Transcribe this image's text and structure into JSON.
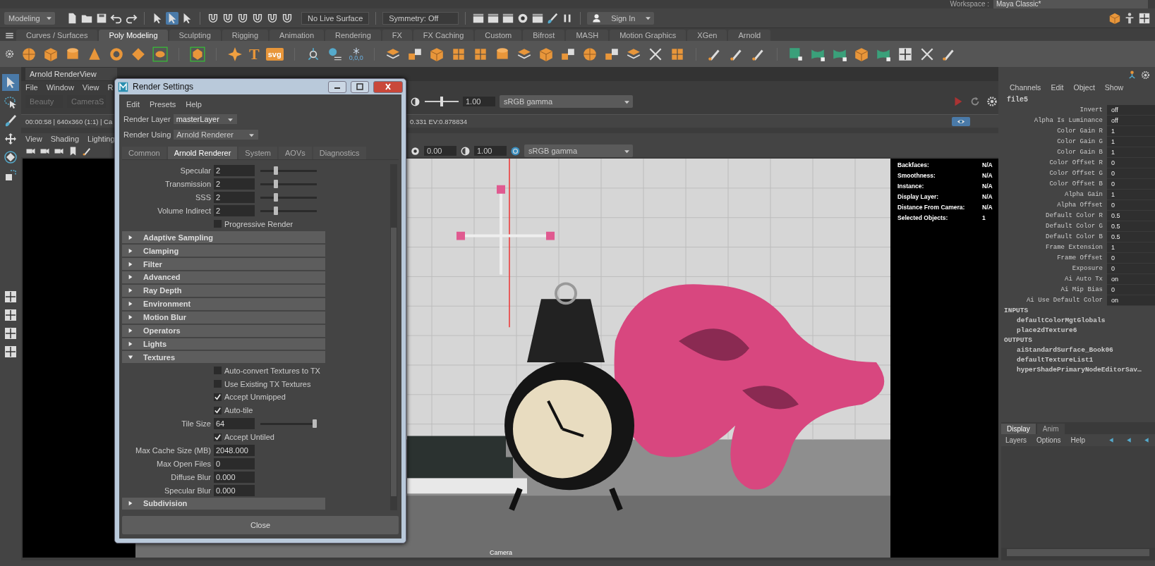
{
  "workspace": {
    "label": "Workspace :",
    "value": "Maya Classic*"
  },
  "status_line": {
    "mode": "Modeling",
    "live_surface": "No Live Surface",
    "symmetry": "Symmetry: Off",
    "sign_in": "Sign In"
  },
  "shelf": {
    "tabs": [
      {
        "label": "Curves / Surfaces",
        "selected": false
      },
      {
        "label": "Poly Modeling",
        "selected": true
      },
      {
        "label": "Sculpting",
        "selected": false
      },
      {
        "label": "Rigging",
        "selected": false
      },
      {
        "label": "Animation",
        "selected": false
      },
      {
        "label": "Rendering",
        "selected": false
      },
      {
        "label": "FX",
        "selected": false
      },
      {
        "label": "FX Caching",
        "selected": false
      },
      {
        "label": "Custom",
        "selected": false
      },
      {
        "label": "Bifrost",
        "selected": false
      },
      {
        "label": "MASH",
        "selected": false
      },
      {
        "label": "Motion Graphics",
        "selected": false
      },
      {
        "label": "XGen",
        "selected": false
      },
      {
        "label": "Arnold",
        "selected": false
      }
    ],
    "text_tool": "T",
    "svg_tool": "svg",
    "origin_readout": "0,0,0"
  },
  "render_view": {
    "title": "Arnold RenderView",
    "menu": [
      "File",
      "Window",
      "View",
      "R"
    ],
    "aov": "Beauty",
    "camera": "CameraS",
    "exposure_slider": {
      "level": 0.5
    },
    "exposure": "1.00",
    "color_space": "sRGB gamma",
    "status_left": "00:00:58 | 640x360 (1:1) | Ca",
    "status_right": "0.331 EV:0.878834"
  },
  "viewport": {
    "menu": [
      "View",
      "Shading",
      "Lighting"
    ],
    "gamma": "0.00",
    "exposure": "1.00",
    "color_space": "sRGB gamma",
    "hud": [
      {
        "label": "Backfaces:",
        "value": "N/A"
      },
      {
        "label": "Smoothness:",
        "value": "N/A"
      },
      {
        "label": "Instance:",
        "value": "N/A"
      },
      {
        "label": "Display Layer:",
        "value": "N/A"
      },
      {
        "label": "Distance From Camera:",
        "value": "N/A"
      },
      {
        "label": "Selected Objects:",
        "value": "1"
      }
    ],
    "camera_label": "Camera"
  },
  "render_settings": {
    "title": "Render Settings",
    "menu": [
      "Edit",
      "Presets",
      "Help"
    ],
    "render_layer_label": "Render Layer",
    "render_layer": "masterLayer",
    "render_using_label": "Render Using",
    "render_using": "Arnold Renderer",
    "tabs": [
      {
        "label": "Common",
        "selected": false
      },
      {
        "label": "Arnold Renderer",
        "selected": true
      },
      {
        "label": "System",
        "selected": false
      },
      {
        "label": "AOVs",
        "selected": false
      },
      {
        "label": "Diagnostics",
        "selected": false
      }
    ],
    "items": [
      {
        "kind": "slider",
        "label": "Specular",
        "value": "2",
        "level": 0.25
      },
      {
        "kind": "slider",
        "label": "Transmission",
        "value": "2",
        "level": 0.25
      },
      {
        "kind": "slider",
        "label": "SSS",
        "value": "2",
        "level": 0.25
      },
      {
        "kind": "slider",
        "label": "Volume Indirect",
        "value": "2",
        "level": 0.25
      },
      {
        "kind": "checkbox",
        "label": "Progressive Render",
        "checked": false
      },
      {
        "kind": "section",
        "label": "Adaptive Sampling",
        "expanded": false
      },
      {
        "kind": "section",
        "label": "Clamping",
        "expanded": false
      },
      {
        "kind": "section",
        "label": "Filter",
        "expanded": false
      },
      {
        "kind": "section",
        "label": "Advanced",
        "expanded": false
      },
      {
        "kind": "section",
        "label": "Ray Depth",
        "expanded": false
      },
      {
        "kind": "section",
        "label": "Environment",
        "expanded": false
      },
      {
        "kind": "section",
        "label": "Motion Blur",
        "expanded": false
      },
      {
        "kind": "section",
        "label": "Operators",
        "expanded": false
      },
      {
        "kind": "section",
        "label": "Lights",
        "expanded": false
      },
      {
        "kind": "section",
        "label": "Textures",
        "expanded": true
      },
      {
        "kind": "checkbox",
        "label": "Auto-convert Textures to TX",
        "checked": false
      },
      {
        "kind": "checkbox",
        "label": "Use Existing TX Textures",
        "checked": false
      },
      {
        "kind": "checkbox",
        "label": "Accept Unmipped",
        "checked": true
      },
      {
        "kind": "checkbox",
        "label": "Auto-tile",
        "checked": true
      },
      {
        "kind": "slider",
        "label": "Tile Size",
        "value": "64",
        "level": 1
      },
      {
        "kind": "checkbox",
        "label": "Accept Untiled",
        "checked": true
      },
      {
        "kind": "field",
        "label": "Max Cache Size (MB)",
        "value": "2048.000"
      },
      {
        "kind": "field",
        "label": "Max Open Files",
        "value": "0"
      },
      {
        "kind": "field",
        "label": "Diffuse Blur",
        "value": "0.000"
      },
      {
        "kind": "field",
        "label": "Specular Blur",
        "value": "0.000"
      },
      {
        "kind": "section",
        "label": "Subdivision",
        "expanded": false
      }
    ],
    "close": "Close"
  },
  "channel_box": {
    "menu": [
      "Channels",
      "Edit",
      "Object",
      "Show"
    ],
    "node": "file5",
    "attributes": [
      {
        "name": "Invert",
        "value": "off"
      },
      {
        "name": "Alpha Is Luminance",
        "value": "off"
      },
      {
        "name": "Color Gain R",
        "value": "1"
      },
      {
        "name": "Color Gain G",
        "value": "1"
      },
      {
        "name": "Color Gain B",
        "value": "1"
      },
      {
        "name": "Color Offset R",
        "value": "0"
      },
      {
        "name": "Color Offset G",
        "value": "0"
      },
      {
        "name": "Color Offset B",
        "value": "0"
      },
      {
        "name": "Alpha Gain",
        "value": "1"
      },
      {
        "name": "Alpha Offset",
        "value": "0"
      },
      {
        "name": "Default Color R",
        "value": "0.5"
      },
      {
        "name": "Default Color G",
        "value": "0.5"
      },
      {
        "name": "Default Color B",
        "value": "0.5"
      },
      {
        "name": "Frame Extension",
        "value": "1"
      },
      {
        "name": "Frame Offset",
        "value": "0"
      },
      {
        "name": "Exposure",
        "value": "0"
      },
      {
        "name": "Ai Auto Tx",
        "value": "on"
      },
      {
        "name": "Ai Mip Bias",
        "value": "0"
      },
      {
        "name": "Ai Use Default Color",
        "value": "on"
      }
    ],
    "inputs_label": "INPUTS",
    "inputs": [
      "defaultColorMgtGlobals",
      "place2dTexture6"
    ],
    "outputs_label": "OUTPUTS",
    "outputs": [
      "aiStandardSurface_Book06",
      "defaultTextureList1",
      "hyperShadePrimaryNodeEditorSav…"
    ]
  },
  "layer_editor": {
    "tabs": [
      {
        "label": "Display",
        "selected": true
      },
      {
        "label": "Anim",
        "selected": false
      }
    ],
    "menu": [
      "Layers",
      "Options",
      "Help"
    ]
  }
}
